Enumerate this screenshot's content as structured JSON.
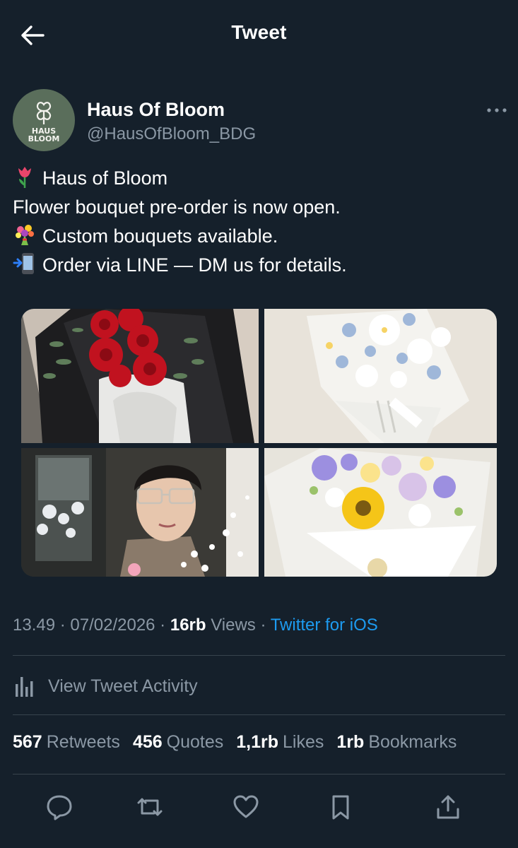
{
  "header": {
    "title": "Tweet",
    "back_icon": "arrow-left-icon"
  },
  "author": {
    "name": "Haus Of Bloom",
    "handle": "@HausOfBloom_BDG",
    "avatar_text_1": "HAUS",
    "avatar_text_2": "BLOOM",
    "avatar_color": "#5a6e5b",
    "more_icon": "more-horizontal-icon"
  },
  "tweet": {
    "lines": [
      {
        "emoji": "tulip-emoji",
        "text": "Haus of Bloom"
      },
      {
        "emoji": "",
        "text": "Flower bouquet pre-order is now open."
      },
      {
        "emoji": "bouquet-emoji",
        "text": "Custom bouquets available."
      },
      {
        "emoji": "mobile-arrow-emoji",
        "text": "Order via LINE — DM us for details."
      }
    ]
  },
  "media": [
    {
      "name": "red-roses-bouquet-image"
    },
    {
      "name": "white-blue-flowers-bouquet-image"
    },
    {
      "name": "man-with-glasses-in-flower-shop-image"
    },
    {
      "name": "sunflower-purple-bouquet-image"
    }
  ],
  "meta": {
    "time": "13.49",
    "sep1": " · ",
    "date": "07/02/2026",
    "sep2": " · ",
    "views_count": "16rb",
    "views_label": " Views",
    "sep3": " · ",
    "source": "Twitter for iOS"
  },
  "activity": {
    "label": "View Tweet Activity",
    "icon": "bar-chart-icon"
  },
  "stats": {
    "retweets_count": "567",
    "retweets_label": "Retweets",
    "quotes_count": "456",
    "quotes_label": "Quotes",
    "likes_count": "1,1rb",
    "likes_label": "Likes",
    "bookmarks_count": "1rb",
    "bookmarks_label": "Bookmarks"
  },
  "actions": [
    "reply-icon",
    "retweet-icon",
    "like-icon",
    "bookmark-icon",
    "share-icon"
  ],
  "colors": {
    "background": "#15202b",
    "secondary_text": "#8b98a5",
    "accent": "#1d9bf0",
    "divider": "#38444d"
  }
}
